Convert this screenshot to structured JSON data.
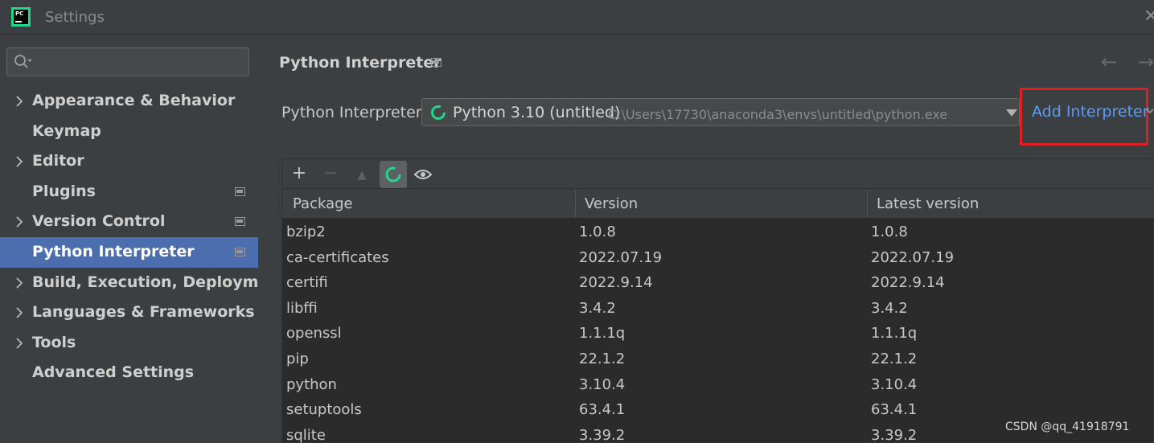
{
  "window": {
    "title": "Settings",
    "logo_text": "PC"
  },
  "search": {
    "placeholder": ""
  },
  "sidebar": {
    "items": [
      {
        "label": "Appearance & Behavior",
        "expandable": true,
        "project": false,
        "selected": false
      },
      {
        "label": "Keymap",
        "expandable": false,
        "project": false,
        "selected": false
      },
      {
        "label": "Editor",
        "expandable": true,
        "project": false,
        "selected": false
      },
      {
        "label": "Plugins",
        "expandable": false,
        "project": true,
        "selected": false
      },
      {
        "label": "Version Control",
        "expandable": true,
        "project": true,
        "selected": false
      },
      {
        "label": "Python Interpreter",
        "expandable": false,
        "project": true,
        "selected": true
      },
      {
        "label": "Build, Execution, Deployment",
        "expandable": true,
        "project": false,
        "selected": false
      },
      {
        "label": "Languages & Frameworks",
        "expandable": true,
        "project": false,
        "selected": false
      },
      {
        "label": "Tools",
        "expandable": true,
        "project": false,
        "selected": false
      },
      {
        "label": "Advanced Settings",
        "expandable": false,
        "project": false,
        "selected": false
      }
    ]
  },
  "main": {
    "title": "Python Interpreter",
    "interpreter_label": "Python Interpreter:",
    "interpreter_name": "Python 3.10 (untitled)",
    "interpreter_path": "C:\\Users\\17730\\anaconda3\\envs\\untitled\\python.exe",
    "add_interpreter": "Add Interpreter",
    "toolbar": {
      "add": "+",
      "remove": "−",
      "up": "▲"
    },
    "columns": [
      "Package",
      "Version",
      "Latest version"
    ],
    "packages": [
      {
        "name": "bzip2",
        "version": "1.0.8",
        "latest": "1.0.8"
      },
      {
        "name": "ca-certificates",
        "version": "2022.07.19",
        "latest": "2022.07.19"
      },
      {
        "name": "certifi",
        "version": "2022.9.14",
        "latest": "2022.9.14"
      },
      {
        "name": "libffi",
        "version": "3.4.2",
        "latest": "3.4.2"
      },
      {
        "name": "openssl",
        "version": "1.1.1q",
        "latest": "1.1.1q"
      },
      {
        "name": "pip",
        "version": "22.1.2",
        "latest": "22.1.2"
      },
      {
        "name": "python",
        "version": "3.10.4",
        "latest": "3.10.4"
      },
      {
        "name": "setuptools",
        "version": "63.4.1",
        "latest": "63.4.1"
      },
      {
        "name": "sqlite",
        "version": "3.39.2",
        "latest": "3.39.2"
      }
    ]
  },
  "watermark": "CSDN @qq_41918791",
  "colors": {
    "accent": "#589df6",
    "selection": "#4b6eaf",
    "highlight_box": "#e02020",
    "spinner": "#21d789"
  }
}
